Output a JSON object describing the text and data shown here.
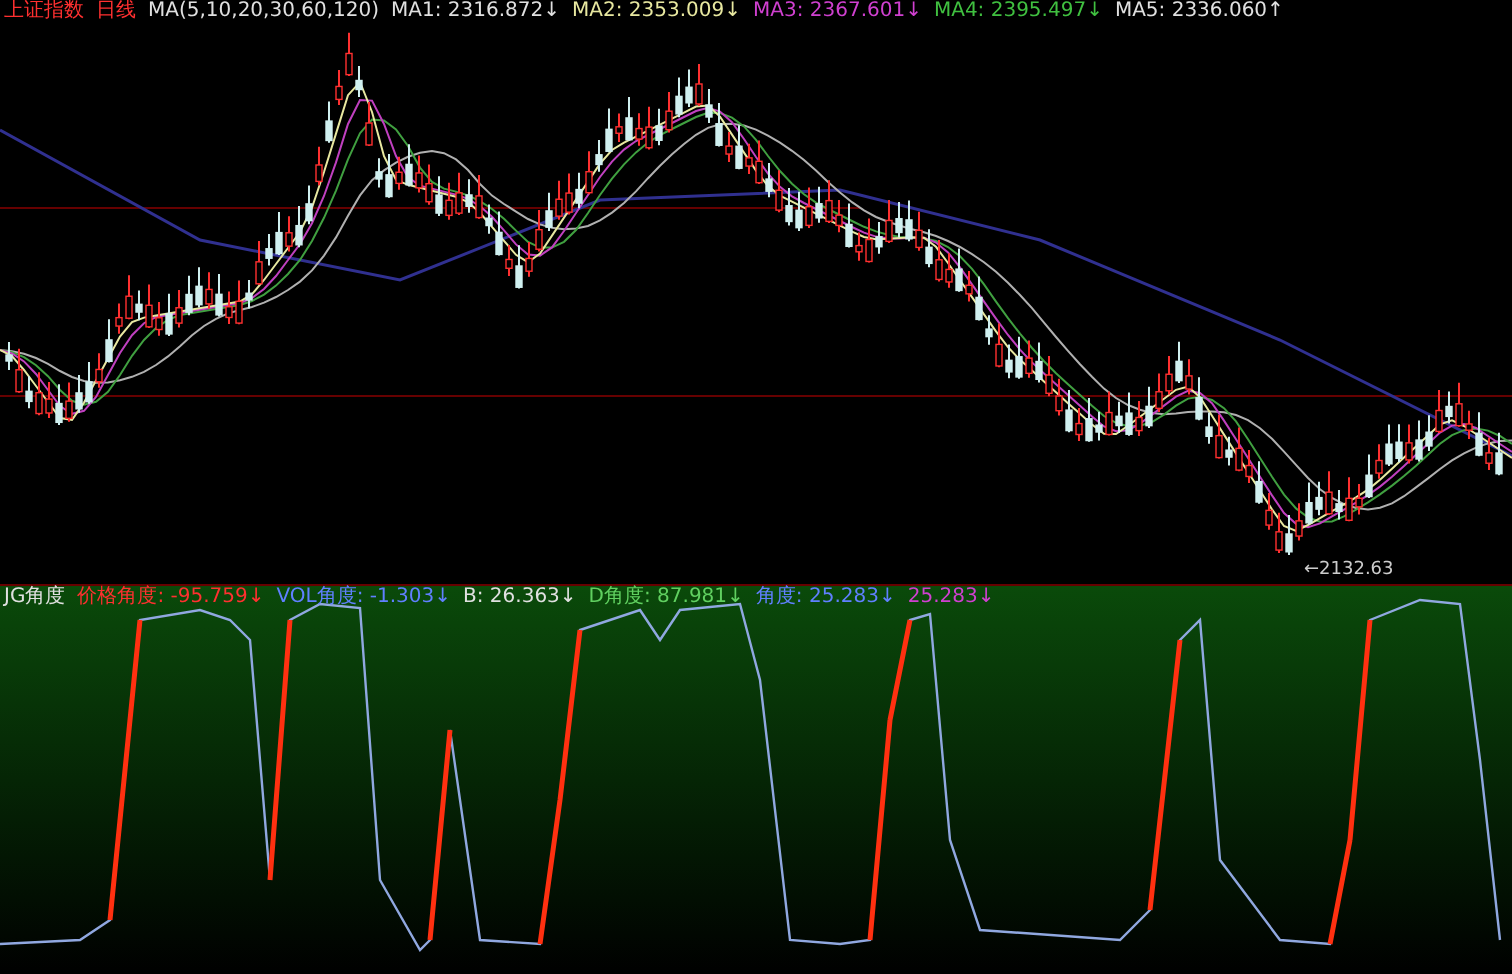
{
  "price_pane": {
    "header": [
      {
        "text": "上证指数",
        "color": "#ff3030"
      },
      {
        "text": "日线",
        "color": "#ff3030"
      },
      {
        "text": "MA(5,10,20,30,60,120)",
        "color": "#e0e0e0"
      },
      {
        "text": "MA1: 2316.872↓",
        "color": "#e0e0e0"
      },
      {
        "text": "MA2: 2353.009↓",
        "color": "#e8e8a0"
      },
      {
        "text": "MA3: 2367.601↓",
        "color": "#d040d0"
      },
      {
        "text": "MA4: 2395.497↓",
        "color": "#40c040"
      },
      {
        "text": "MA5: 2336.060↑",
        "color": "#e0e0e0"
      }
    ],
    "low_label": "←2132.63"
  },
  "indicator_pane": {
    "header": [
      {
        "text": "JG角度",
        "color": "#e0e0e0"
      },
      {
        "text": "价格角度: -95.759↓",
        "color": "#ff3030"
      },
      {
        "text": "VOL角度: -1.303↓",
        "color": "#6080ff"
      },
      {
        "text": "B: 26.363↓",
        "color": "#e0e0e0"
      },
      {
        "text": "D角度: 87.981↓",
        "color": "#60d060"
      },
      {
        "text": "角度: 25.283↓",
        "color": "#6080ff"
      },
      {
        "text": "25.283↓",
        "color": "#d040d0"
      }
    ]
  }
}
